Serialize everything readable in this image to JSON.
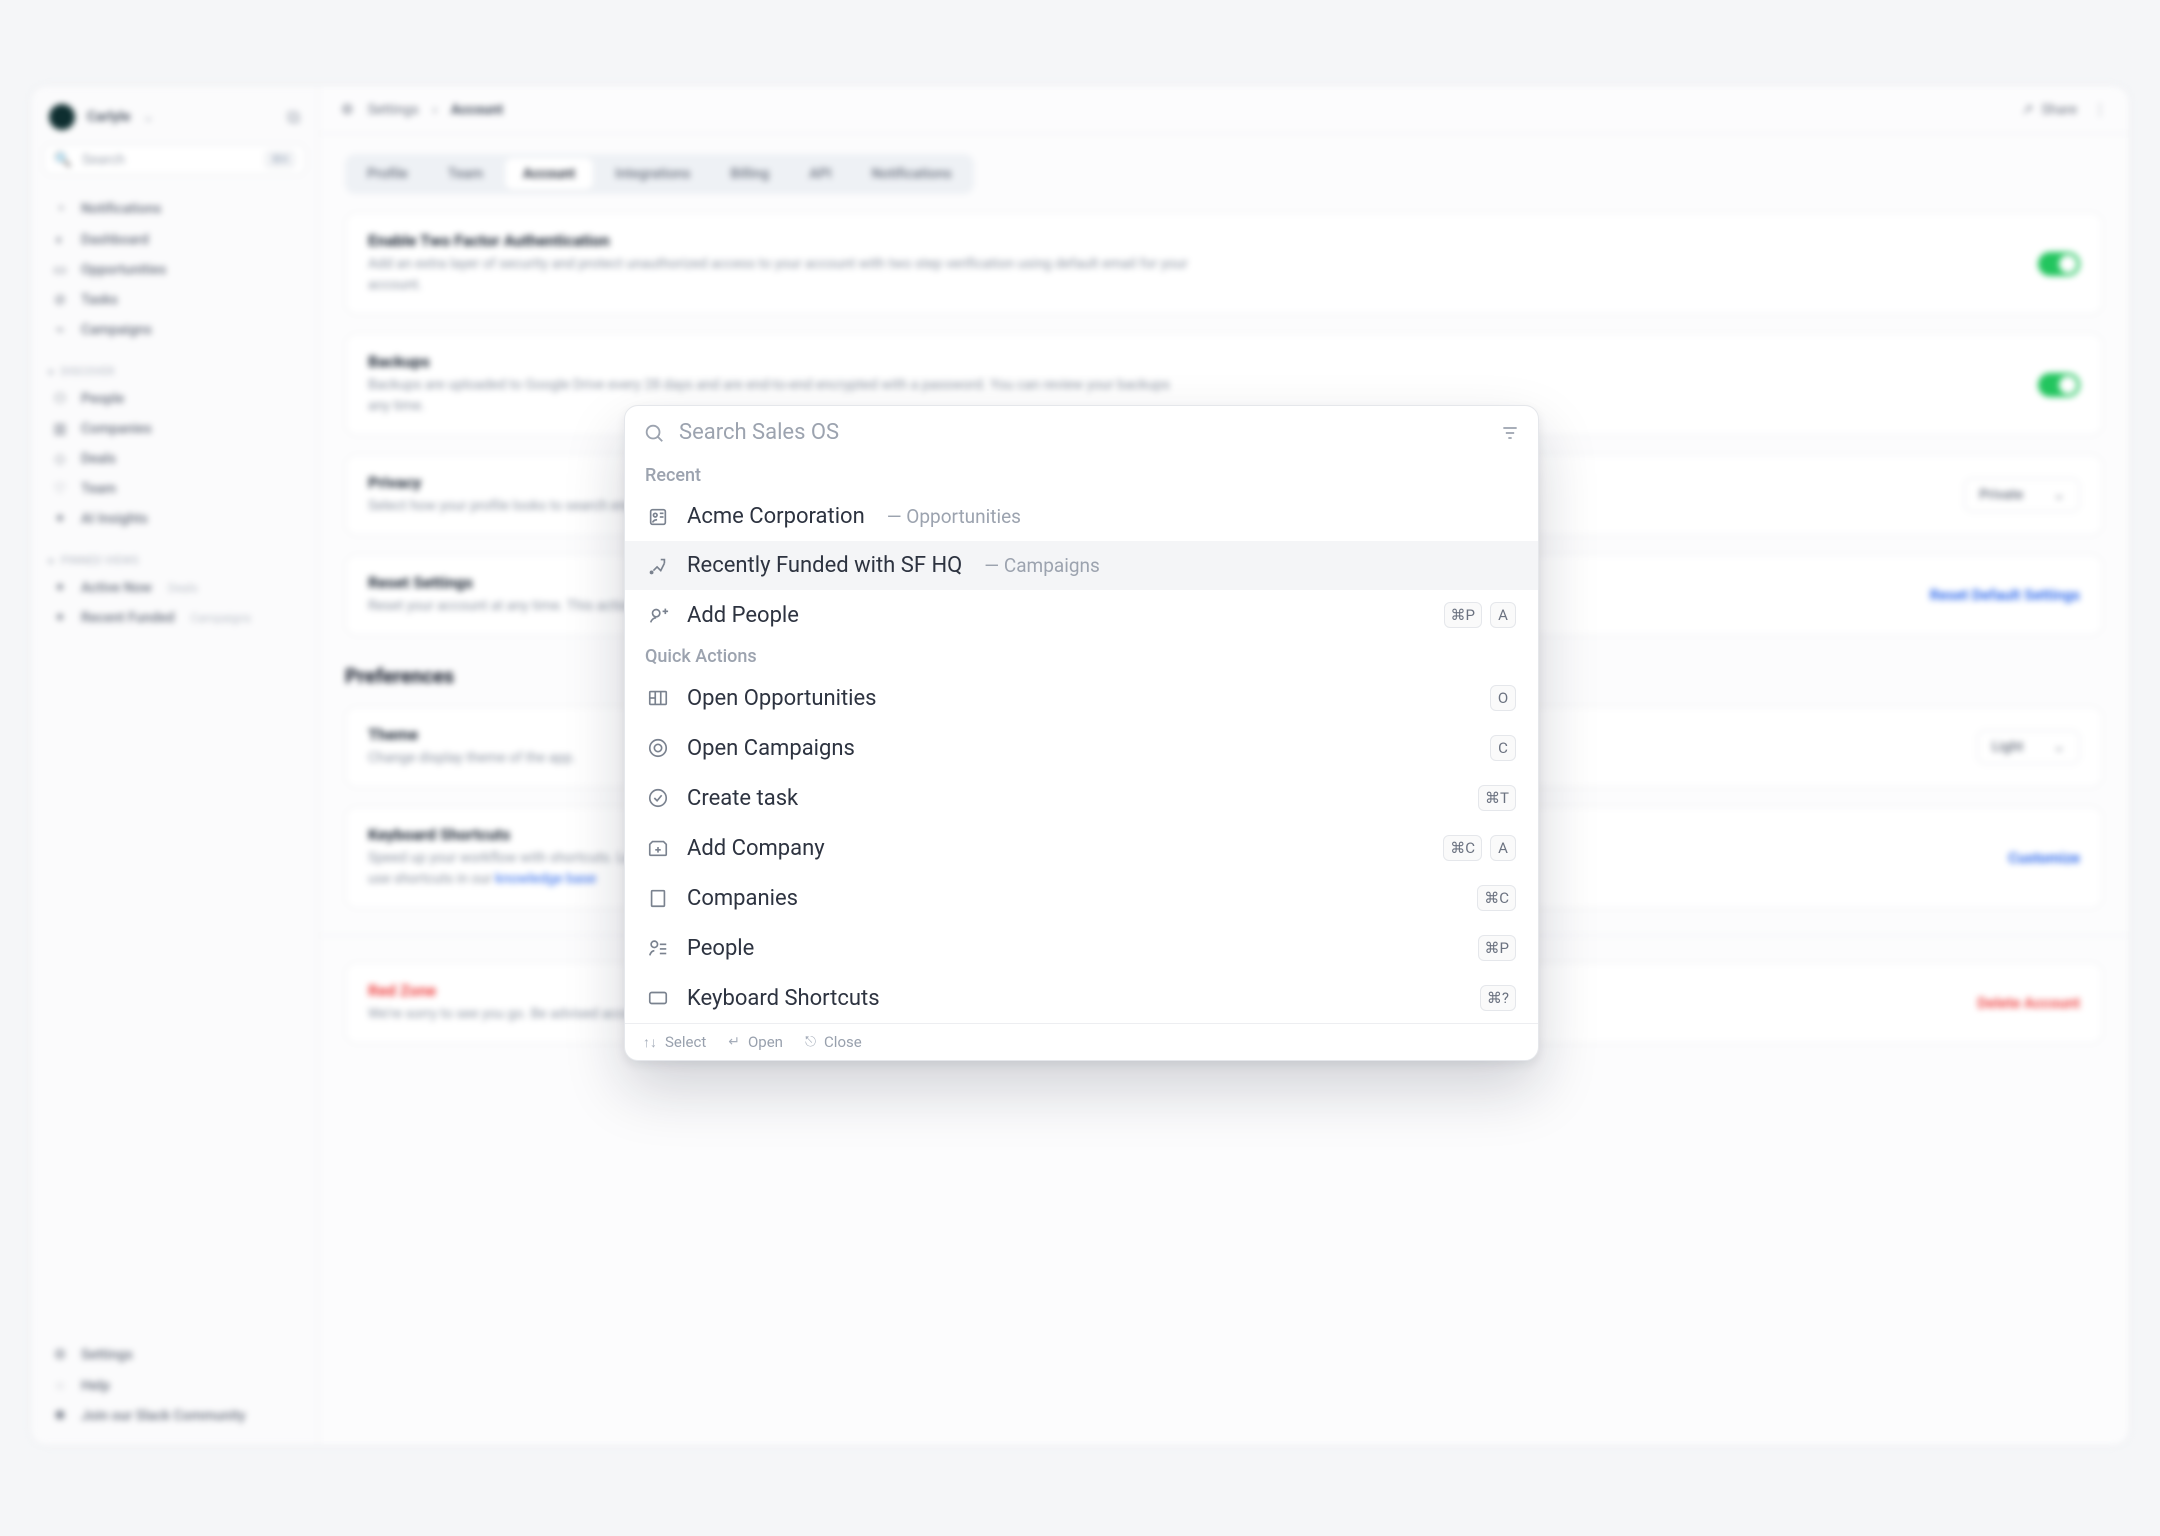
{
  "user": {
    "name": "Carlyle"
  },
  "sidebar": {
    "search_placeholder": "Search",
    "search_kbd": "⌘K",
    "main": [
      {
        "label": "Notifications"
      },
      {
        "label": "Dashboard"
      },
      {
        "label": "Opportunities"
      },
      {
        "label": "Tasks"
      },
      {
        "label": "Campaigns"
      }
    ],
    "discover_title": "Discover",
    "discover": [
      {
        "label": "People"
      },
      {
        "label": "Companies"
      },
      {
        "label": "Deals"
      },
      {
        "label": "Team"
      },
      {
        "label": "AI Insights"
      }
    ],
    "pinned_title": "Pinned Views",
    "pinned": [
      {
        "label": "Active Now",
        "tag": "Deals"
      },
      {
        "label": "Recent Funded",
        "tag": "Campaigns"
      }
    ],
    "footer": [
      {
        "label": "Settings"
      },
      {
        "label": "Help"
      },
      {
        "label": "Join our Slack Community"
      }
    ]
  },
  "breadcrumb": {
    "root": "Settings",
    "current": "Account"
  },
  "share_label": "Share",
  "tabs": [
    "Profile",
    "Team",
    "Account",
    "Integrations",
    "Billing",
    "API",
    "Notifications"
  ],
  "active_tab": "Account",
  "cards": {
    "twofa": {
      "title": "Enable Two Factor Authentication",
      "desc": "Add an extra layer of security and protect unauthorized access to your account with two step verification using default email for your account."
    },
    "backups": {
      "title": "Backups",
      "desc": "Backups are uploaded to Google Drive every 28 days and are end-to-end encrypted with a password. You can review your backups any time."
    },
    "privacy": {
      "title": "Privacy",
      "desc": "Select how your profile looks to search engines and non Sales OS users.",
      "select": "Private"
    },
    "reset": {
      "title": "Reset Settings",
      "desc": "Reset your account at any time. This action will only restore your settings. It will not affect your settings without your knowledge.",
      "action": "Reset Default Settings"
    },
    "theme": {
      "title": "Theme",
      "desc": "Change display theme of the app.",
      "select": "Light"
    },
    "shortcuts": {
      "title": "Keyboard Shortcuts",
      "desc_a": "Speed up your workflow with shortcuts. Learn how to ",
      "desc_link": "knowledge base",
      "desc_b": "use shortcuts in our ",
      "action": "Customize"
    },
    "redzone": {
      "title": "Red Zone",
      "desc": "We're sorry to see you go. Be advised account deletion is final. There will be no way to restore your account.",
      "action": "Delete Account"
    }
  },
  "preferences_title": "Preferences",
  "palette": {
    "placeholder": "Search Sales OS",
    "recent_title": "Recent",
    "recent": [
      {
        "label": "Acme Corporation",
        "context": "Opportunities",
        "keys": []
      },
      {
        "label": "Recently Funded with SF HQ",
        "context": "Campaigns",
        "keys": [],
        "hover": true
      },
      {
        "label": "Add People",
        "context": "",
        "keys": [
          "⌘P",
          "A"
        ]
      }
    ],
    "quick_title": "Quick Actions",
    "quick": [
      {
        "label": "Open Opportunities",
        "keys": [
          "O"
        ]
      },
      {
        "label": "Open Campaigns",
        "keys": [
          "C"
        ]
      },
      {
        "label": "Create task",
        "keys": [
          "⌘T"
        ]
      },
      {
        "label": "Add Company",
        "keys": [
          "⌘C",
          "A"
        ]
      },
      {
        "label": "Companies",
        "keys": [
          "⌘C"
        ]
      },
      {
        "label": "People",
        "keys": [
          "⌘P"
        ]
      },
      {
        "label": "Keyboard Shortcuts",
        "keys": [
          "⌘?"
        ]
      }
    ],
    "footer": {
      "select": "Select",
      "open": "Open",
      "close": "Close"
    }
  }
}
